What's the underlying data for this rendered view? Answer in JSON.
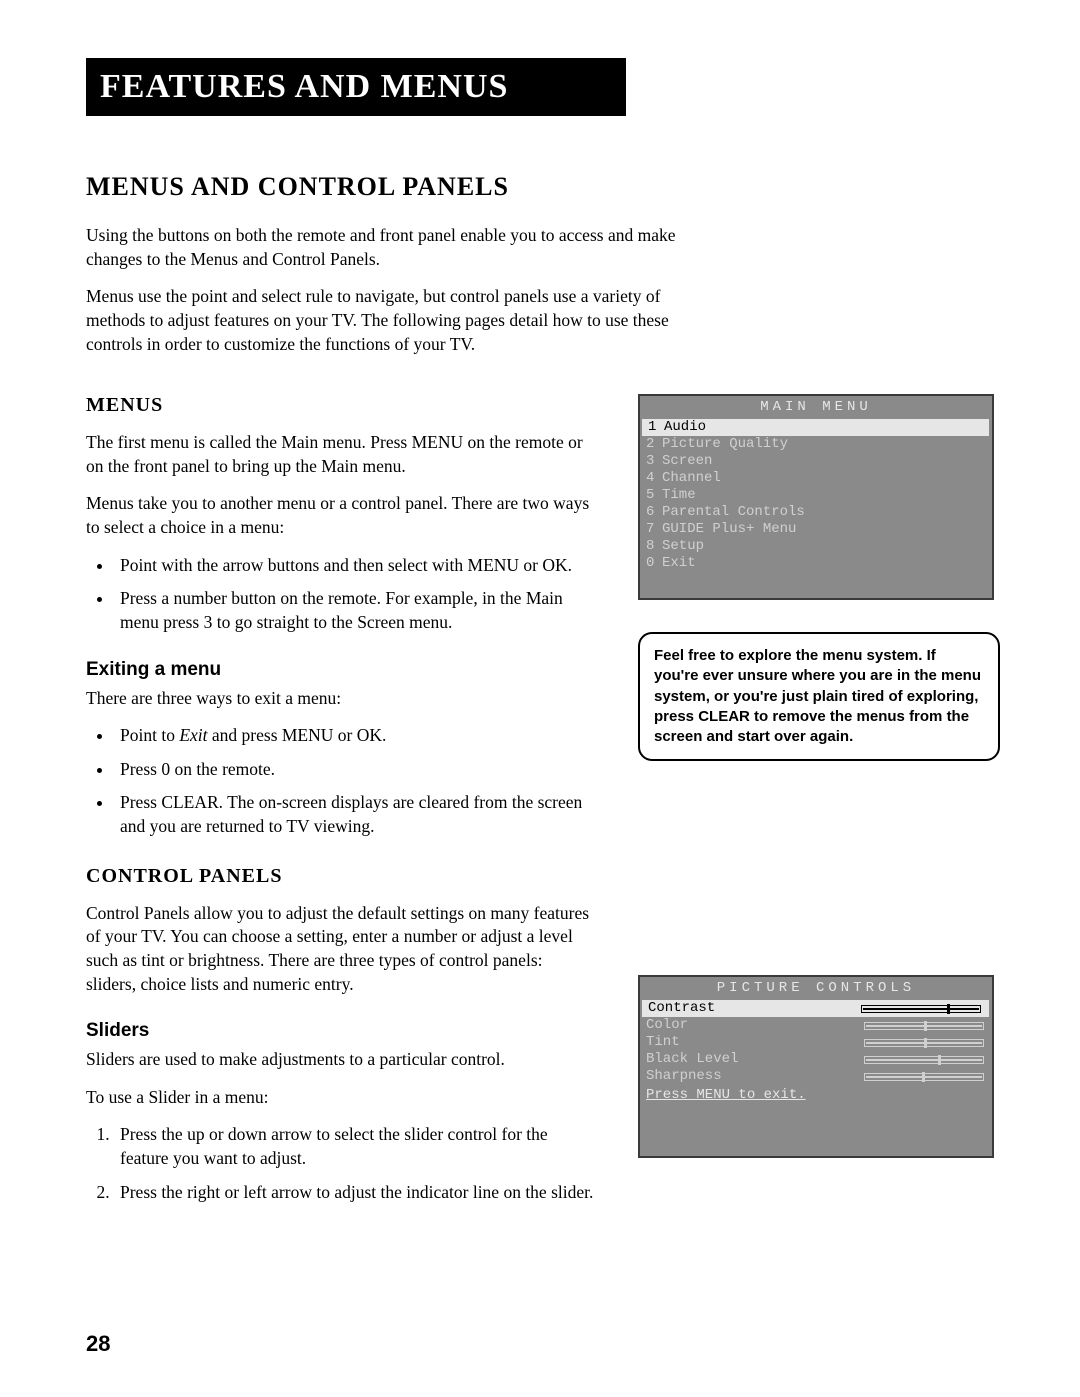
{
  "header": "Features and Menus",
  "h2": "Menus and Control Panels",
  "intro": {
    "p1": "Using the buttons on both the remote and front panel enable you to access and make changes to the Menus and Control Panels.",
    "p2": "Menus use the point and select rule to navigate, but control panels use a variety of methods to adjust features on your TV. The following pages detail how to use these controls in order to customize the functions of your TV."
  },
  "menus": {
    "title": "Menus",
    "p1": "The first menu is called the Main menu. Press MENU on the remote or on the front panel to bring up the Main menu.",
    "p2": "Menus take you to another menu or a control panel. There are two ways to select a choice in a menu:",
    "bullets": {
      "b1": "Point with the arrow buttons and then select with MENU or OK.",
      "b2": "Press a number button on the remote. For example, in the Main menu press 3 to go straight to the Screen menu."
    },
    "exit_title": "Exiting a menu",
    "exit_p": "There are three ways to exit a menu:",
    "exit_bullets": {
      "e1a": "Point to ",
      "e1b": "Exit",
      "e1c": " and press MENU or OK.",
      "e2": "Press 0 on the remote.",
      "e3": "Press CLEAR. The on-screen displays are cleared from the screen and you are returned to TV viewing."
    }
  },
  "panels": {
    "title": "Control Panels",
    "p1": "Control Panels allow you to adjust the default settings on many features of your TV. You can choose a setting, enter a number or adjust a level such as tint or brightness. There are three types of control panels: sliders, choice lists and numeric entry.",
    "sliders_title": "Sliders",
    "sp1": "Sliders are used to make adjustments to a particular control.",
    "sp2": "To use a Slider in a menu:",
    "steps": {
      "s1": "Press the up or down arrow to select the slider control for the feature you want to adjust.",
      "s2": "Press the right or left arrow to adjust the indicator line on the slider."
    }
  },
  "osd1": {
    "title": "MAIN MENU",
    "items": [
      {
        "n": "1",
        "label": "Audio",
        "sel": true
      },
      {
        "n": "2",
        "label": "Picture Quality"
      },
      {
        "n": "3",
        "label": "Screen"
      },
      {
        "n": "4",
        "label": "Channel"
      },
      {
        "n": "5",
        "label": "Time"
      },
      {
        "n": "6",
        "label": "Parental Controls"
      },
      {
        "n": "7",
        "label": "GUIDE Plus+ Menu"
      },
      {
        "n": "8",
        "label": "Setup"
      },
      {
        "n": "0",
        "label": "Exit"
      }
    ]
  },
  "callout": "Feel free to explore the menu system. If you're ever unsure where you are in the menu system, or you're just plain tired of exploring, press CLEAR to remove the menus from the screen and start over again.",
  "osd2": {
    "title": "PICTURE CONTROLS",
    "items": [
      {
        "label": "Contrast",
        "pos": 72,
        "sel": true
      },
      {
        "label": "Color",
        "pos": 50
      },
      {
        "label": "Tint",
        "pos": 50
      },
      {
        "label": "Black Level",
        "pos": 62
      },
      {
        "label": "Sharpness",
        "pos": 48
      }
    ],
    "exit": "Press MENU to exit."
  },
  "page_number": "28"
}
